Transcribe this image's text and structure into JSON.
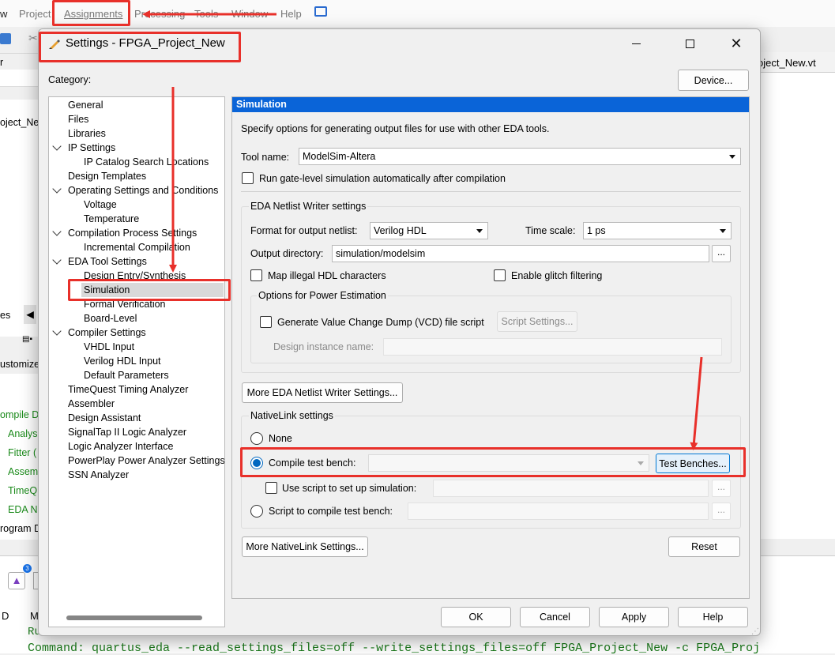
{
  "main_window": {
    "menu": [
      "w",
      "Project",
      "Assignments",
      "Processing",
      "Tools",
      "Window",
      "Help"
    ],
    "right_tab": "oject_New.vt",
    "left_panel_texts": [
      "r",
      "oject_New",
      "es",
      "ustomize",
      "ompile D",
      "Analys",
      "Fitter (",
      "Assem",
      "TimeQ",
      "EDA N",
      "rogram D"
    ],
    "bottom": {
      "col_d": "D",
      "col_m": "M",
      "partial_line": "Ru",
      "command": "Command: quartus_eda --read_settings_files=off --write_settings_files=off FPGA_Project_New -c FPGA_Proj"
    },
    "notification_badge": "3"
  },
  "dialog": {
    "title": "Settings - FPGA_Project_New",
    "category_label": "Category:",
    "device_button": "Device...",
    "category_tree": [
      {
        "label": "General",
        "level": 0
      },
      {
        "label": "Files",
        "level": 0
      },
      {
        "label": "Libraries",
        "level": 0
      },
      {
        "label": "IP Settings",
        "level": 0,
        "expandable": true
      },
      {
        "label": "IP Catalog Search Locations",
        "level": 1
      },
      {
        "label": "Design Templates",
        "level": 0
      },
      {
        "label": "Operating Settings and Conditions",
        "level": 0,
        "expandable": true
      },
      {
        "label": "Voltage",
        "level": 1
      },
      {
        "label": "Temperature",
        "level": 1
      },
      {
        "label": "Compilation Process Settings",
        "level": 0,
        "expandable": true
      },
      {
        "label": "Incremental Compilation",
        "level": 1
      },
      {
        "label": "EDA Tool Settings",
        "level": 0,
        "expandable": true
      },
      {
        "label": "Design Entry/Synthesis",
        "level": 1
      },
      {
        "label": "Simulation",
        "level": 1,
        "selected": true
      },
      {
        "label": "Formal Verification",
        "level": 1
      },
      {
        "label": "Board-Level",
        "level": 1
      },
      {
        "label": "Compiler Settings",
        "level": 0,
        "expandable": true
      },
      {
        "label": "VHDL Input",
        "level": 1
      },
      {
        "label": "Verilog HDL Input",
        "level": 1
      },
      {
        "label": "Default Parameters",
        "level": 1
      },
      {
        "label": "TimeQuest Timing Analyzer",
        "level": 0
      },
      {
        "label": "Assembler",
        "level": 0
      },
      {
        "label": "Design Assistant",
        "level": 0
      },
      {
        "label": "SignalTap II Logic Analyzer",
        "level": 0
      },
      {
        "label": "Logic Analyzer Interface",
        "level": 0
      },
      {
        "label": "PowerPlay Power Analyzer Settings",
        "level": 0
      },
      {
        "label": "SSN Analyzer",
        "level": 0
      }
    ],
    "simulation": {
      "header": "Simulation",
      "description": "Specify options for generating output files for use with other EDA tools.",
      "tool_name_label": "Tool name:",
      "tool_name_value": "ModelSim-Altera",
      "run_gate_level": "Run gate-level simulation automatically after compilation",
      "netlist_group": "EDA Netlist Writer settings",
      "format_label": "Format for output netlist:",
      "format_value": "Verilog HDL",
      "timescale_label": "Time scale:",
      "timescale_value": "1 ps",
      "output_dir_label": "Output directory:",
      "output_dir_value": "simulation/modelsim",
      "browse": "...",
      "map_illegal": "Map illegal HDL characters",
      "enable_glitch": "Enable glitch filtering",
      "power_group": "Options for Power Estimation",
      "gen_vcd": "Generate Value Change Dump (VCD) file script",
      "script_settings": "Script Settings...",
      "design_instance_label": "Design instance name:",
      "more_netlist": "More EDA Netlist Writer Settings...",
      "nativelink_group": "NativeLink settings",
      "opt_none": "None",
      "opt_compile_tb": "Compile test bench:",
      "test_benches": "Test Benches...",
      "use_script": "Use script to set up simulation:",
      "opt_script_compile": "Script to compile test bench:",
      "more_nativelink": "More NativeLink Settings...",
      "reset": "Reset"
    },
    "footer": {
      "ok": "OK",
      "cancel": "Cancel",
      "apply": "Apply",
      "help": "Help"
    }
  },
  "colors": {
    "header_blue": "#0a64d8",
    "annotation_red": "#e8302a",
    "selection": "#d9d9d9"
  }
}
